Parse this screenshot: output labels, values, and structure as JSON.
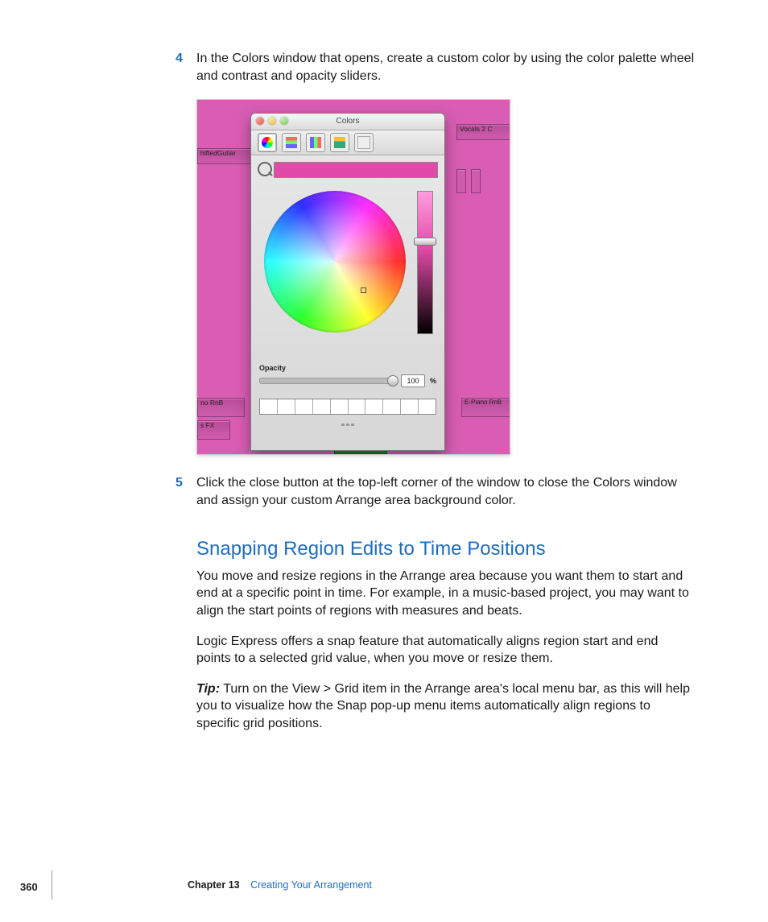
{
  "steps": {
    "s4": {
      "num": "4",
      "text": "In the Colors window that opens, create a custom color by using the color palette wheel and contrast and opacity sliders."
    },
    "s5": {
      "num": "5",
      "text": "Click the close button at the top-left corner of the window to close the Colors window and assign your custom Arrange area background color."
    }
  },
  "screenshot": {
    "window_title": "Colors",
    "opacity_label": "Opacity",
    "opacity_value": "100",
    "percent": "%",
    "tracks": {
      "shifted": "hiftedGutiar",
      "vocals": "Vocals 2 C",
      "rnb_left": "no RnB",
      "fx": "s FX",
      "rnb_right": "E-Piano RnB"
    }
  },
  "section": {
    "heading": "Snapping Region Edits to Time Positions",
    "p1": "You move and resize regions in the Arrange area because you want them to start and end at a specific point in time. For example, in a music-based project, you may want to align the start points of regions with measures and beats.",
    "p2": "Logic Express offers a snap feature that automatically aligns region start and end points to a selected grid value, when you move or resize them.",
    "tip_label": "Tip:",
    "tip_text": " Turn on the View > Grid item in the Arrange area's local menu bar, as this will help you to visualize how the Snap pop-up menu items automatically align regions to specific grid positions."
  },
  "footer": {
    "page": "360",
    "chapter": "Chapter 13",
    "title": "Creating Your Arrangement"
  }
}
